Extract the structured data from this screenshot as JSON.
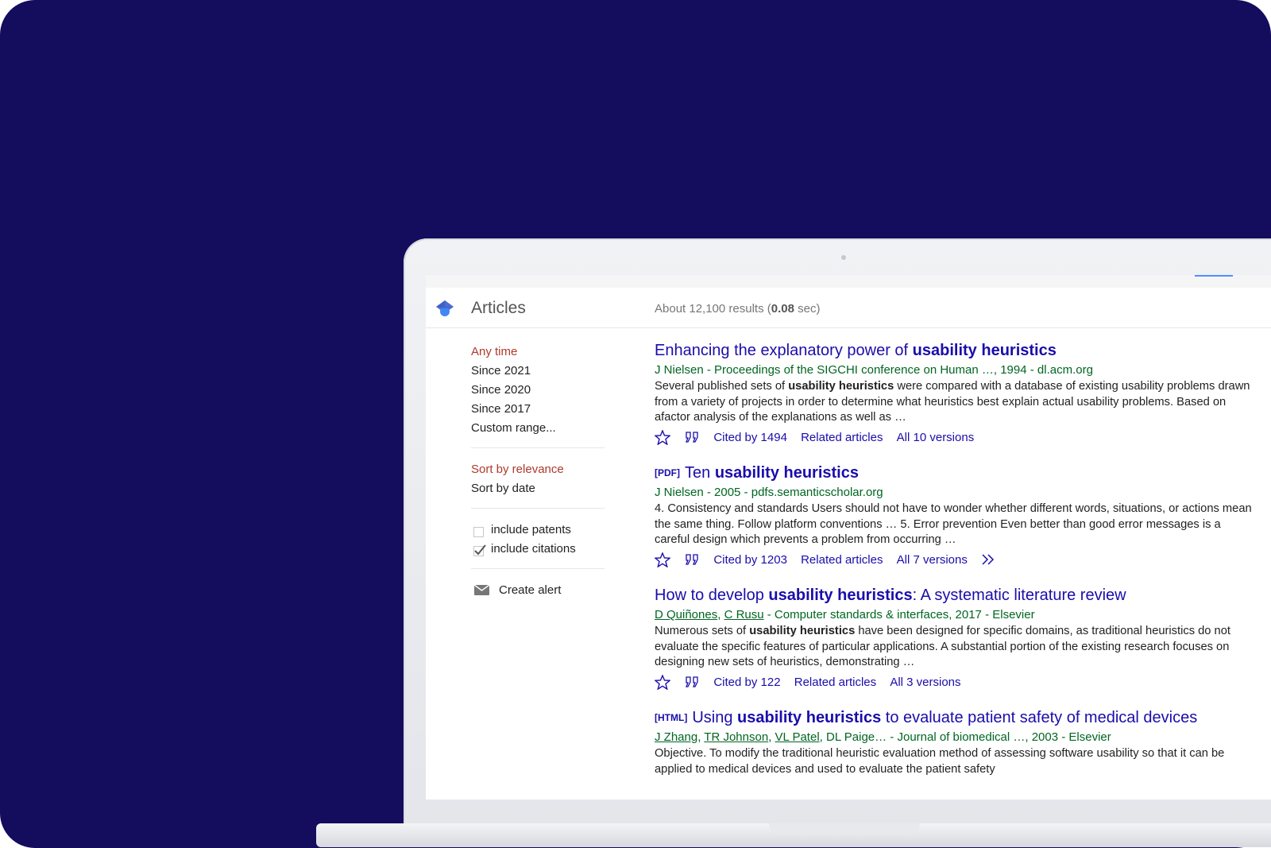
{
  "header": {
    "section_title": "Articles",
    "results_count_prefix": "About 12,100 results (",
    "results_time": "0.08",
    "results_count_suffix": " sec)"
  },
  "sidebar": {
    "time_filters": [
      {
        "label": "Any time",
        "selected": true
      },
      {
        "label": "Since 2021",
        "selected": false
      },
      {
        "label": "Since 2020",
        "selected": false
      },
      {
        "label": "Since 2017",
        "selected": false
      },
      {
        "label": "Custom range...",
        "selected": false
      }
    ],
    "sort_options": [
      {
        "label": "Sort by relevance",
        "selected": true
      },
      {
        "label": "Sort by date",
        "selected": false
      }
    ],
    "include_patents": {
      "label": "include patents",
      "checked": false
    },
    "include_citations": {
      "label": "include citations",
      "checked": true
    },
    "create_alert": "Create alert"
  },
  "results": [
    {
      "type_tag": "",
      "title_pre": "Enhancing the explanatory power of ",
      "title_kw": "usability heuristics",
      "title_post": "",
      "meta": "J Nielsen - Proceedings of the SIGCHI conference on Human …, 1994 - dl.acm.org",
      "snippet_pre": "Several published sets of ",
      "snippet_kw": "usability heuristics",
      "snippet_post": " were compared with a database of existing usability problems drawn from a variety of projects in order to determine what heuristics best explain actual usability problems. Based on afactor analysis of the explanations as well as …",
      "cited_by": "Cited by 1494",
      "related": "Related articles",
      "versions": "All 10 versions"
    },
    {
      "type_tag": "[PDF]",
      "title_pre": "Ten ",
      "title_kw": "usability heuristics",
      "title_post": "",
      "meta": "J Nielsen - 2005 - pdfs.semanticscholar.org",
      "snippet": "4. Consistency and standards Users should not have to wonder whether different words, situations, or actions mean the same thing. Follow platform conventions … 5. Error prevention Even better than good error messages is a careful design which prevents a problem from occurring …",
      "cited_by": "Cited by 1203",
      "related": "Related articles",
      "versions": "All 7 versions"
    },
    {
      "type_tag": "",
      "title_pre": "How to develop ",
      "title_kw": "usability heuristics",
      "title_post": ": A systematic literature review",
      "authors": [
        "D Quiñones",
        "C Rusu"
      ],
      "meta_rest": " - Computer standards & interfaces, 2017 - Elsevier",
      "snippet_pre": "Numerous sets of ",
      "snippet_kw": "usability heuristics",
      "snippet_post": " have been designed for specific domains, as traditional heuristics do not evaluate the specific features of particular applications. A substantial portion of the existing research focuses on designing new sets of heuristics, demonstrating …",
      "cited_by": "Cited by 122",
      "related": "Related articles",
      "versions": "All 3 versions"
    },
    {
      "type_tag": "[HTML]",
      "title_pre": "Using ",
      "title_kw": "usability heuristics",
      "title_post": " to evaluate patient safety of medical devices",
      "authors": [
        "J Zhang",
        "TR Johnson",
        "VL Patel"
      ],
      "meta_rest": ", DL Paige… - Journal of biomedical …, 2003 - Elsevier",
      "snippet": "Objective. To modify the traditional heuristic evaluation method of assessing software usability so that it can be applied to medical devices and used to evaluate the patient safety"
    }
  ]
}
